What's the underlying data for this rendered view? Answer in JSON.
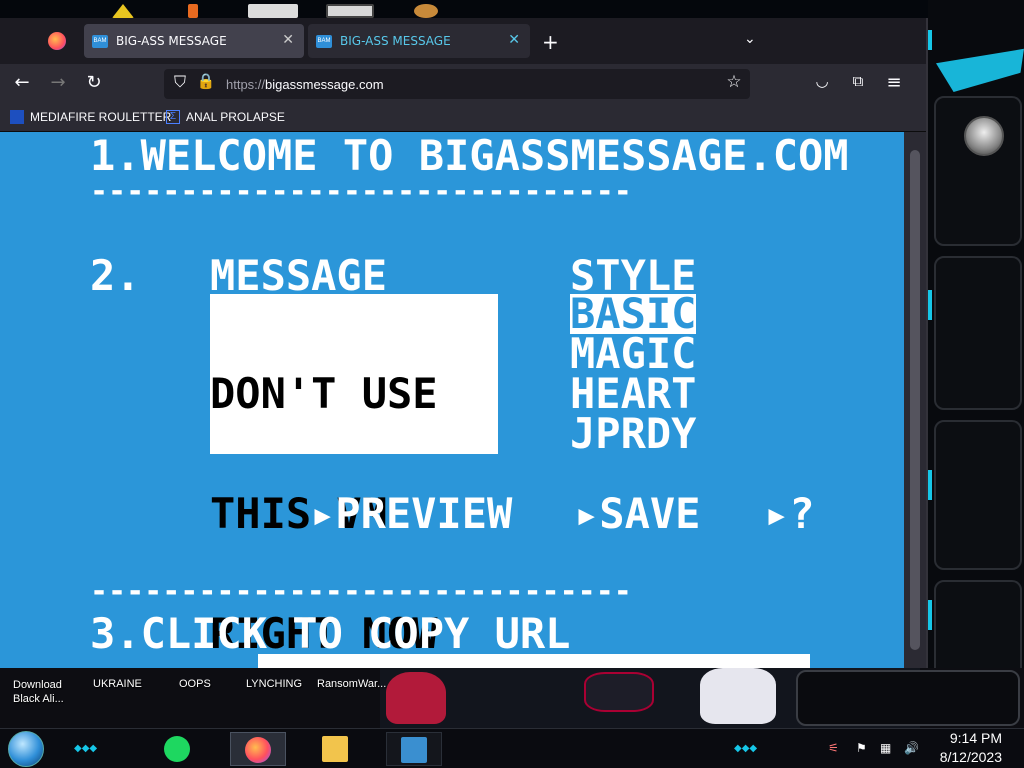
{
  "browser": {
    "tabs": [
      {
        "favicon": "BAM",
        "label": "BIG-ASS MESSAGE"
      },
      {
        "favicon": "BAM",
        "label": "BIG-ASS MESSAGE"
      }
    ],
    "address": {
      "protocol": "https://",
      "host": "bigassmessage.com"
    },
    "bookmarks": [
      {
        "label": "MEDIAFIRE ROULETTER",
        "icon": "mft-icon"
      },
      {
        "label": "ANAL PROLAPSE",
        "icon": "sigma-icon"
      }
    ]
  },
  "page": {
    "step1": "1.WELCOME TO BIGASSMESSAGE.COM",
    "divider": "------------------------------",
    "step2_num": "2.",
    "message_heading": "MESSAGE",
    "style_heading": "STYLE",
    "message_lines": [
      "DON'T USE",
      "THIS VM",
      "RIGHT NOW"
    ],
    "styles": [
      "BASIC",
      "MAGIC",
      "HEART",
      "JPRDY"
    ],
    "selected_style": "BASIC",
    "actions": {
      "preview": "▸PREVIEW",
      "save": "▸SAVE",
      "help": "▸?"
    },
    "step3": "3.CLICK TO COPY URL"
  },
  "desktop": {
    "icons": [
      "Download\nBlack Ali...",
      "UKRAINE",
      "OOPS",
      "LYNCHING",
      "RansomWar..."
    ]
  },
  "taskbar": {
    "time": "9:14 PM",
    "date": "8/12/2023"
  },
  "colors": {
    "page_bg": "#2b96d9",
    "tab_active_text": "#58c8ea",
    "gadget_red": "#ff2020",
    "gadget_cyan": "#16c7e8"
  }
}
